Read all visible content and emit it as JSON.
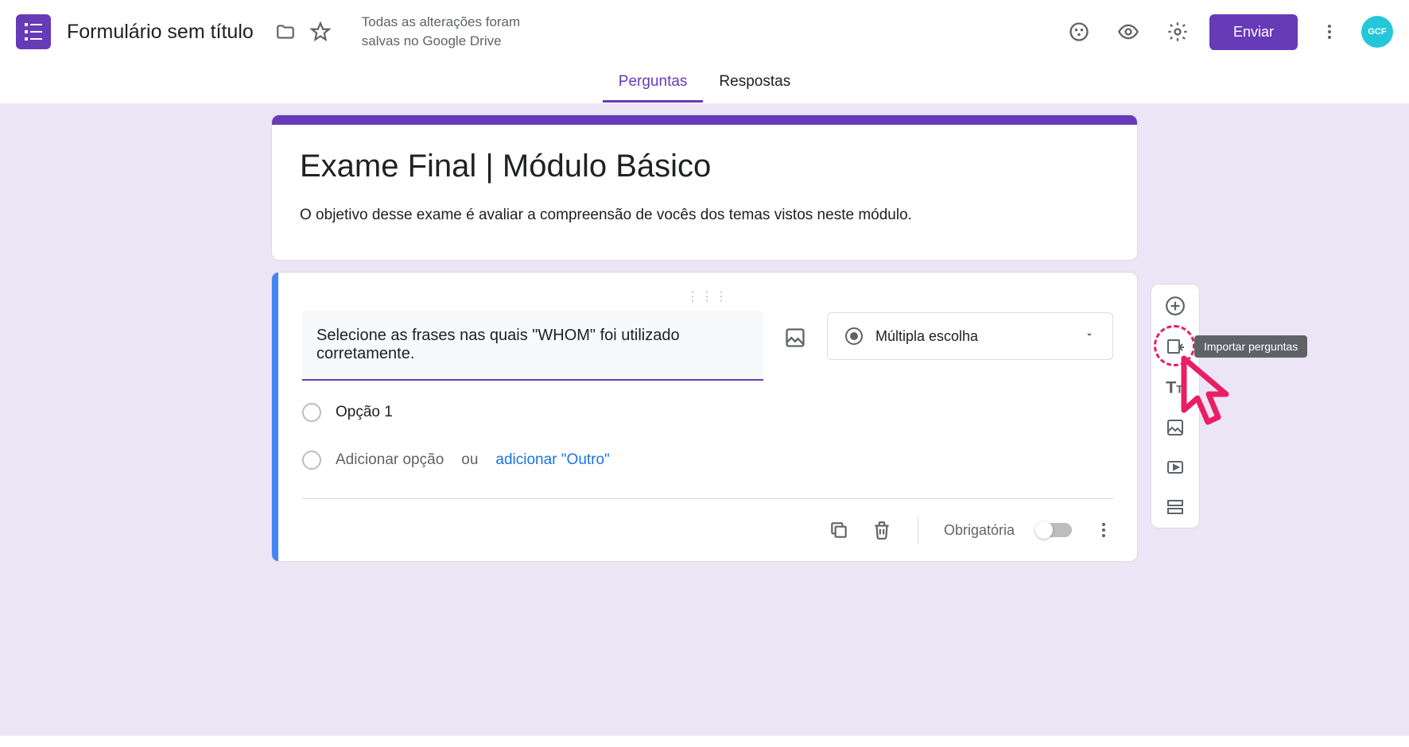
{
  "header": {
    "doc_title": "Formulário sem título",
    "save_status": "Todas as alterações foram salvas no Google Drive",
    "send_label": "Enviar",
    "avatar_label": "GCF"
  },
  "tabs": {
    "questions": "Perguntas",
    "responses": "Respostas"
  },
  "form": {
    "title": "Exame Final | Módulo Básico",
    "description": "O objetivo desse exame é avaliar a compreensão de vocês dos temas vistos neste módulo."
  },
  "question": {
    "text": "Selecione as frases nas quais \"WHOM\" foi utilizado corretamente.",
    "type_label": "Múltipla escolha",
    "option1": "Opção 1",
    "add_option": "Adicionar opção",
    "or_text": "ou",
    "add_other": "adicionar \"Outro\"",
    "required_label": "Obrigatória"
  },
  "tooltip": {
    "import_questions": "Importar perguntas"
  }
}
